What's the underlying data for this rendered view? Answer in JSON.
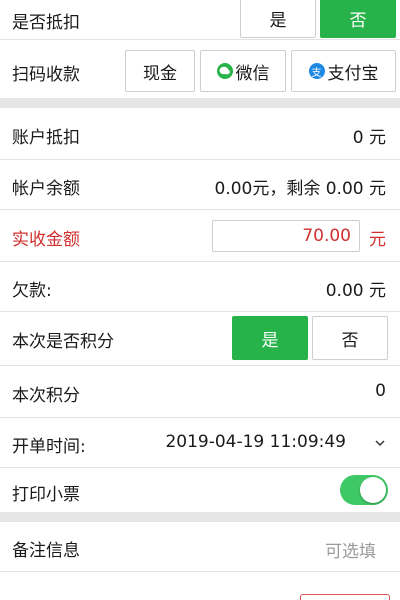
{
  "deduct_row": {
    "label": "是否抵扣",
    "yes": "是",
    "no": "否"
  },
  "scan_row": {
    "label": "扫码收款",
    "cash": "现金",
    "wechat": "微信",
    "alipay": "支付宝",
    "wechat_color": "#27b24a",
    "alipay_color": "#1e88e5"
  },
  "account_deduct": {
    "label": "账户抵扣",
    "value": "0 元"
  },
  "account_balance": {
    "label": "帐户余额",
    "value": "0.00元，剩余 0.00 元"
  },
  "actual_amount": {
    "label": "实收金额",
    "value": "70.00",
    "unit": "元"
  },
  "debt": {
    "label": "欠款:",
    "value": "0.00 元"
  },
  "points_row": {
    "label": "本次是否积分",
    "yes": "是",
    "no": "否"
  },
  "points": {
    "label": "本次积分",
    "value": "0"
  },
  "open_time": {
    "label": "开单时间:",
    "value": "2019-04-19 11:09:49"
  },
  "print_ticket": {
    "label": "打印小票",
    "enabled": true
  },
  "remark": {
    "label": "备注信息",
    "placeholder": "可选填"
  },
  "colors": {
    "green": "#27b24a",
    "red": "#d32f2f",
    "toggle_on": "#3fc866"
  }
}
